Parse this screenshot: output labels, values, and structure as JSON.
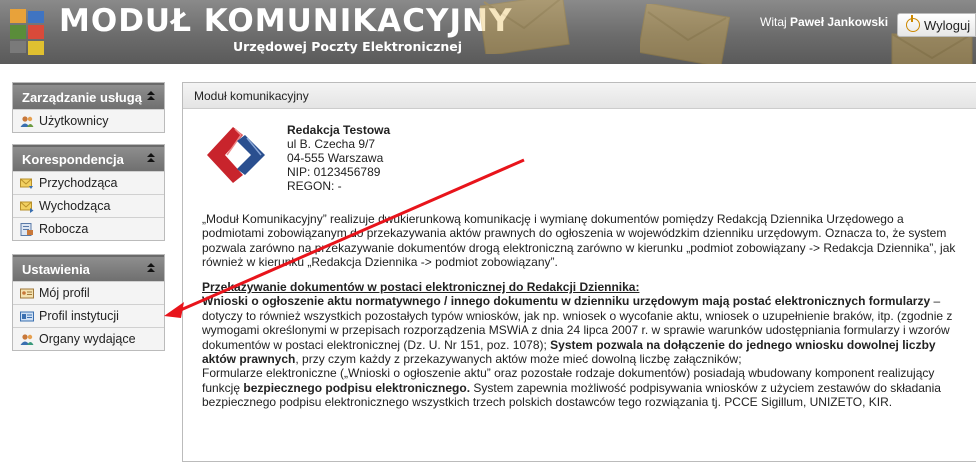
{
  "header": {
    "app_title": "MODUŁ KOMUNIKACYJNY",
    "app_subtitle": "Urzędowej Poczty Elektronicznej",
    "greeting_prefix": "Witaj",
    "user_name": "Paweł Jankowski",
    "logout_label": "Wyloguj"
  },
  "sidebar": {
    "panels": [
      {
        "title": "Zarządzanie usługą",
        "items": [
          {
            "label": "Użytkownicy",
            "icon": "users-icon"
          }
        ]
      },
      {
        "title": "Korespondencja",
        "items": [
          {
            "label": "Przychodząca",
            "icon": "inbox-icon"
          },
          {
            "label": "Wychodząca",
            "icon": "outbox-icon"
          },
          {
            "label": "Robocza",
            "icon": "drafts-icon"
          }
        ]
      },
      {
        "title": "Ustawienia",
        "items": [
          {
            "label": "Mój profil",
            "icon": "profile-card-icon"
          },
          {
            "label": "Profil instytucji",
            "icon": "institution-card-icon"
          },
          {
            "label": "Organy wydające",
            "icon": "issuers-icon"
          }
        ]
      }
    ]
  },
  "main": {
    "panel_title": "Moduł komunikacyjny",
    "institution": {
      "name": "Redakcja Testowa",
      "street": "ul B. Czecha 9/7",
      "city": "04-555 Warszawa",
      "nip": "NIP: 0123456789",
      "regon": "REGON: -"
    },
    "intro": "„Moduł Komunikacyjny” realizuje dwukierunkową komunikację i wymianę dokumentów pomiędzy Redakcją Dziennika Urzędowego a podmiotami zobowiązanym do przekazywania aktów prawnych do ogłoszenia w wojewódzkim dzienniku urzędowym. Oznacza to, że system pozwala zarówno na przekazywanie dokumentów drogą elektroniczną zarówno w kierunku „podmiot zobowiązany -> Redakcja Dziennika”, jak również w kierunku „Redakcja Dziennika -> podmiot zobowiązany”.",
    "section_heading": "Przekazywanie dokumentów w postaci elektronicznej do Redakcji Dziennika:",
    "p1_bold": "Wnioski o ogłoszenie aktu normatywnego / innego dokumentu w dzienniku urzędowym mają postać elektronicznych formularzy",
    "p1_rest": " – dotyczy to również wszystkich pozostałych typów wniosków, jak np. wniosek o wycofanie aktu, wniosek o uzupełnienie braków, itp. (zgodnie z wymogami określonymi w przepisach rozporządzenia MSWiA z dnia 24 lipca 2007 r. w sprawie warunków udostępniania formularzy i wzorów dokumentów w postaci elektronicznej (Dz. U. Nr 151, poz. 1078);",
    "p1_bold2": " System pozwala na dołączenie do jednego wniosku dowolnej liczby aktów prawnych",
    "p1_rest2": ", przy czym każdy z przekazywanych aktów może mieć dowolną liczbę załączników;",
    "p2_a": "Formularze elektroniczne („Wnioski o ogłoszenie aktu” oraz pozostałe rodzaje dokumentów) posiadają wbudowany komponent realizujący funkcję ",
    "p2_bold": "bezpiecznego podpisu elektronicznego.",
    "p2_b": " System zapewnia możliwość podpisywania wniosków z użyciem zestawów do składania bezpiecznego podpisu elektronicznego wszystkich trzech polskich dostawców tego rozwiązania tj. PCCE Sigillum, UNIZETO, KIR."
  },
  "colors": {
    "header_gray": "#6c6c6c",
    "panel_head_gray": "#7f7f7f",
    "annotation_arrow": "#e8141b",
    "logo_red": "#c8242c",
    "logo_blue": "#2a4f8f"
  }
}
